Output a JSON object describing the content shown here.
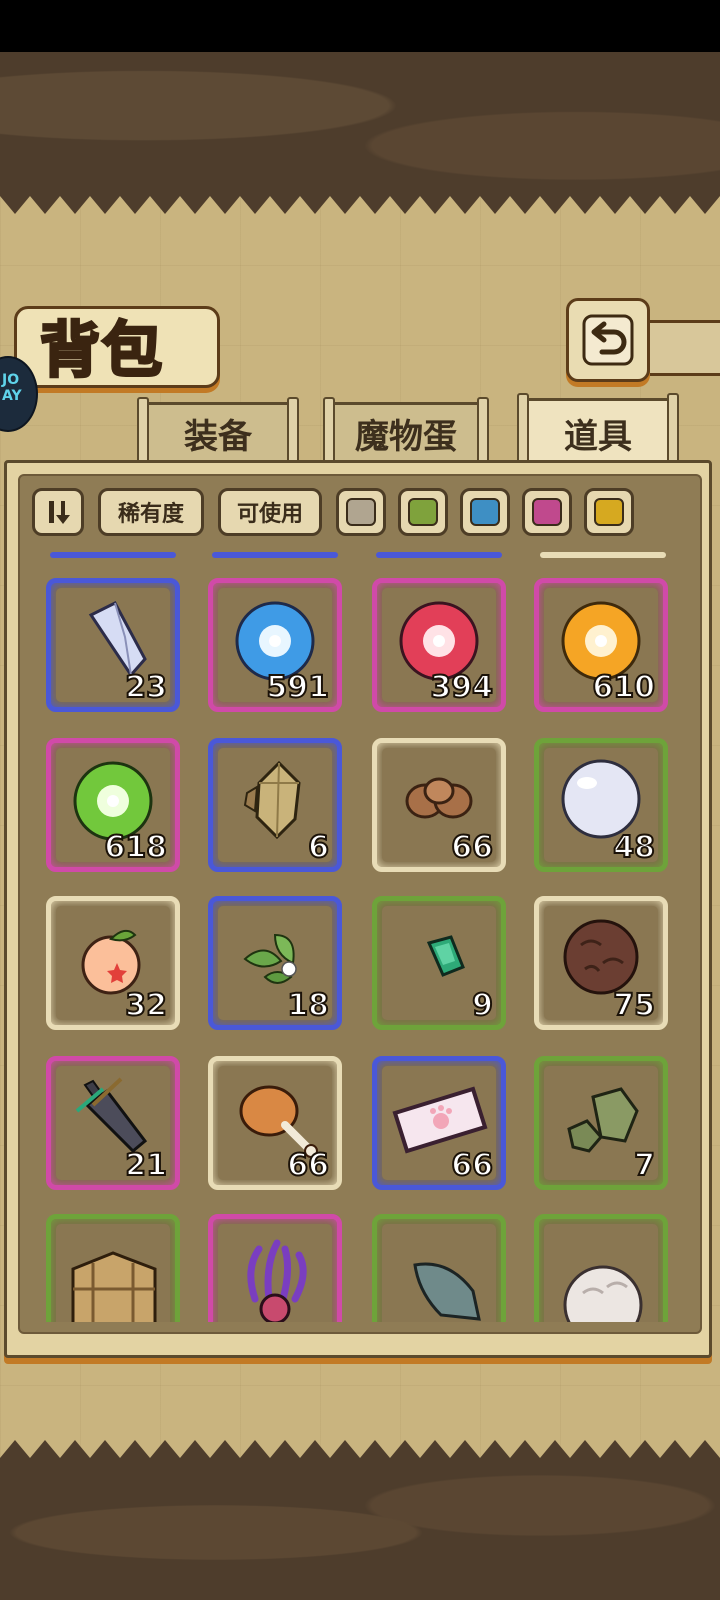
{
  "title": "背包",
  "tabs": [
    {
      "label": "装备",
      "active": false
    },
    {
      "label": "魔物蛋",
      "active": false
    },
    {
      "label": "道具",
      "active": true
    }
  ],
  "filters": {
    "rarity_label": "稀有度",
    "usable_label": "可使用",
    "color_chips": [
      "#b0a590",
      "#7fa23c",
      "#3e8fc4",
      "#c0498d",
      "#d6a920"
    ]
  },
  "rarity_colors": {
    "white": "#e8dcb6",
    "green": "#6ea33a",
    "blue": "#4a58d8",
    "purple": "#d04aa8"
  },
  "items": [
    {
      "name": "crystal-shard",
      "count": "23",
      "rarity": "blue"
    },
    {
      "name": "blue-orb",
      "count": "591",
      "rarity": "purple"
    },
    {
      "name": "red-orb",
      "count": "394",
      "rarity": "purple"
    },
    {
      "name": "orange-orb",
      "count": "610",
      "rarity": "purple"
    },
    {
      "name": "green-orb",
      "count": "618",
      "rarity": "purple"
    },
    {
      "name": "ore-chunk",
      "count": "6",
      "rarity": "blue"
    },
    {
      "name": "yarn-bundle",
      "count": "66",
      "rarity": "white"
    },
    {
      "name": "white-pearl",
      "count": "48",
      "rarity": "green"
    },
    {
      "name": "peach-fruit",
      "count": "32",
      "rarity": "white"
    },
    {
      "name": "herb-leaf",
      "count": "18",
      "rarity": "blue"
    },
    {
      "name": "emerald-gem",
      "count": "9",
      "rarity": "green"
    },
    {
      "name": "fur-ball",
      "count": "75",
      "rarity": "white"
    },
    {
      "name": "broken-sword",
      "count": "21",
      "rarity": "purple"
    },
    {
      "name": "meat-drumstick",
      "count": "66",
      "rarity": "white"
    },
    {
      "name": "paw-ticket",
      "count": "66",
      "rarity": "blue"
    },
    {
      "name": "green-stone",
      "count": "7",
      "rarity": "green"
    },
    {
      "name": "wooden-crate",
      "count": "",
      "rarity": "green"
    },
    {
      "name": "tentacle-creature",
      "count": "",
      "rarity": "purple"
    },
    {
      "name": "stone-fang",
      "count": "",
      "rarity": "green"
    },
    {
      "name": "white-fur",
      "count": "",
      "rarity": "green"
    }
  ]
}
